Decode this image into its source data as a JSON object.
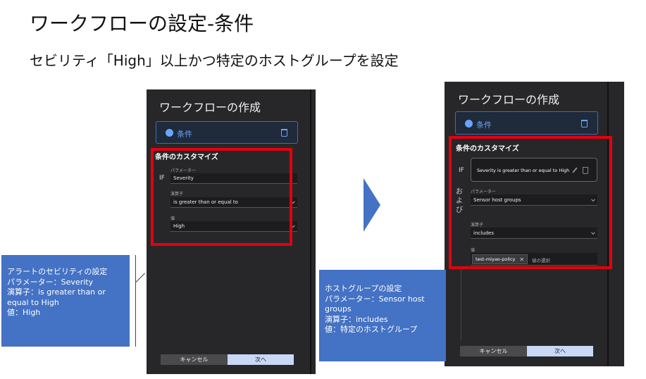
{
  "slide": {
    "title": "ワークフローの設定-条件",
    "subtitle": "セビリティ「High」以上かつ特定のホストグループを設定"
  },
  "left_panel": {
    "title": "ワークフローの作成",
    "condition_label": "条件",
    "customize_title": "条件のカスタマイズ",
    "if_label": "IF",
    "parameter_label": "パラメーター",
    "parameter_value": "Severity",
    "operator_label": "演算子",
    "operator_value": "is greater than or equal to",
    "value_label": "値",
    "value_value": "High",
    "cancel_label": "キャンセル",
    "next_label": "次へ"
  },
  "left_callout": {
    "text": " アラートのセビリティの設定\nパラメーター：Severity\n演算子：is greater than or\nequal to High\n値：High"
  },
  "right_panel": {
    "title": "ワークフローの作成",
    "condition_label": "条件",
    "customize_title": "条件のカスタマイズ",
    "if_label": "IF",
    "if_condition_text": "Severity is greater than or equal to High",
    "and_label": "および",
    "parameter_label": "パラメーター",
    "parameter_value": "Sensor host groups",
    "operator_label": "演算子",
    "operator_value": "includes",
    "value_label": "値",
    "chip_value": "test-miyao-policy",
    "value_placeholder": "値の選択",
    "cancel_label": "キャンセル",
    "next_label": "次へ"
  },
  "right_callout": {
    "text": "ホストグループの設定\nパラメーター：Sensor host\ngroups\n演算子：includes\n値：特定のホストグループ"
  },
  "colors": {
    "accent_blue": "#4472c4",
    "highlight_red": "#e3000f",
    "panel_dark": "#27272a"
  }
}
